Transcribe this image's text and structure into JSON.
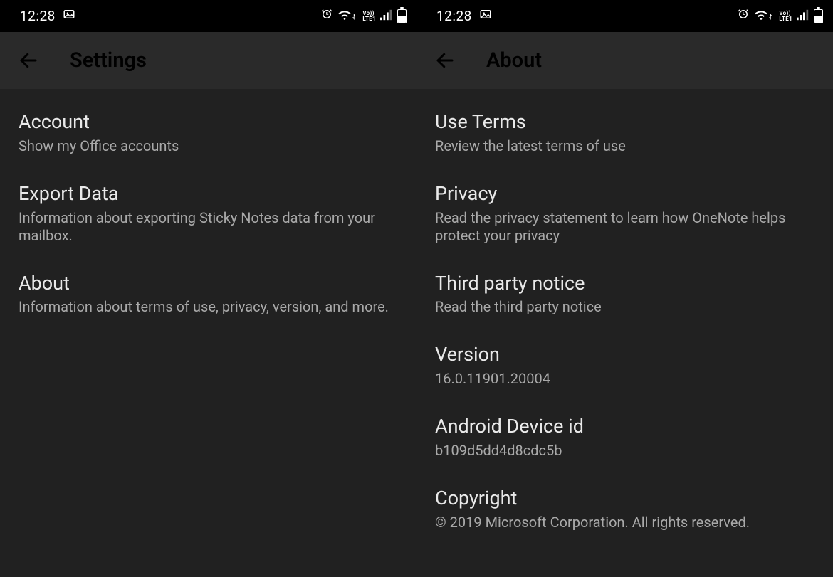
{
  "status": {
    "time": "12:28",
    "lte_top": "Vo))",
    "lte_bot": "LTE1",
    "battery_level_pct": 45
  },
  "left": {
    "title": "Settings",
    "items": [
      {
        "title": "Account",
        "sub": "Show my Office accounts"
      },
      {
        "title": "Export Data",
        "sub": "Information about exporting Sticky Notes data from your mailbox."
      },
      {
        "title": "About",
        "sub": "Information about terms of use, privacy, version, and more."
      }
    ]
  },
  "right": {
    "title": "About",
    "items": [
      {
        "title": "Use Terms",
        "sub": "Review the latest terms of use"
      },
      {
        "title": "Privacy",
        "sub": "Read the privacy statement to learn how OneNote helps protect your privacy"
      },
      {
        "title": "Third party notice",
        "sub": "Read the third party notice"
      },
      {
        "title": "Version",
        "sub": "16.0.11901.20004"
      },
      {
        "title": "Android Device id",
        "sub": "b109d5dd4d8cdc5b"
      },
      {
        "title": "Copyright",
        "sub": "© 2019 Microsoft Corporation. All rights reserved."
      }
    ]
  }
}
